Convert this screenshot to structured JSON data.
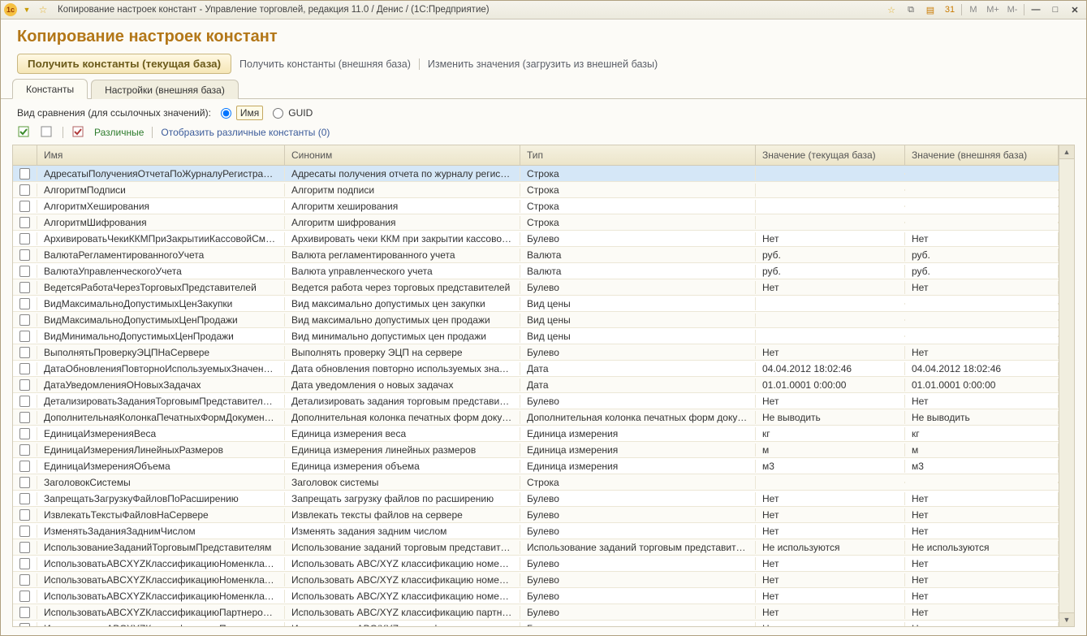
{
  "titlebar": {
    "title": "Копирование настроек констант - Управление торговлей, редакция 11.0 / Денис /  (1С:Предприятие)"
  },
  "page_title": "Копирование настроек констант",
  "actions": {
    "get_current": "Получить константы (текущая база)",
    "get_external": "Получить константы (внешняя база)",
    "change_values": "Изменить значения (загрузить из внешней базы)"
  },
  "tabs": {
    "constants": "Константы",
    "settings_ext": "Настройки (внешняя база)"
  },
  "compare_mode": {
    "label": "Вид сравнения (для ссылочных значений):",
    "name": "Имя",
    "guid": "GUID"
  },
  "subtools": {
    "diff": "Различные",
    "show_diff": "Отобразить различные константы (0)"
  },
  "columns": {
    "name": "Имя",
    "syn": "Синоним",
    "type": "Тип",
    "v1": "Значение (текущая база)",
    "v2": "Значение (внешняя база)"
  },
  "rows": [
    {
      "name": "АдресатыПолученияОтчетаПоЖурналуРегистрации",
      "syn": "Адресаты получения отчета по журналу регистрации",
      "type": "Строка",
      "v1": "",
      "v2": "",
      "selected": true
    },
    {
      "name": "АлгоритмПодписи",
      "syn": "Алгоритм подписи",
      "type": "Строка",
      "v1": "",
      "v2": ""
    },
    {
      "name": "АлгоритмХеширования",
      "syn": "Алгоритм хеширования",
      "type": "Строка",
      "v1": "",
      "v2": ""
    },
    {
      "name": "АлгоритмШифрования",
      "syn": "Алгоритм шифрования",
      "type": "Строка",
      "v1": "",
      "v2": ""
    },
    {
      "name": "АрхивироватьЧекиККМПриЗакрытииКассовойСмены",
      "syn": "Архивировать чеки ККМ при закрытии кассовой сме...",
      "type": "Булево",
      "v1": "Нет",
      "v2": "Нет"
    },
    {
      "name": "ВалютаРегламентированногоУчета",
      "syn": "Валюта регламентированного учета",
      "type": "Валюта",
      "v1": "руб.",
      "v2": "руб."
    },
    {
      "name": "ВалютаУправленческогоУчета",
      "syn": "Валюта управленческого учета",
      "type": "Валюта",
      "v1": "руб.",
      "v2": "руб."
    },
    {
      "name": "ВедетсяРаботаЧерезТорговыхПредставителей",
      "syn": "Ведется работа через торговых представителей",
      "type": "Булево",
      "v1": "Нет",
      "v2": "Нет"
    },
    {
      "name": "ВидМаксимальноДопустимыхЦенЗакупки",
      "syn": "Вид максимально допустимых цен закупки",
      "type": "Вид цены",
      "v1": "",
      "v2": ""
    },
    {
      "name": "ВидМаксимальноДопустимыхЦенПродажи",
      "syn": "Вид максимально допустимых цен продажи",
      "type": "Вид цены",
      "v1": "",
      "v2": ""
    },
    {
      "name": "ВидМинимальноДопустимыхЦенПродажи",
      "syn": "Вид минимально допустимых цен продажи",
      "type": "Вид цены",
      "v1": "",
      "v2": ""
    },
    {
      "name": "ВыполнятьПроверкуЭЦПНаСервере",
      "syn": "Выполнять проверку ЭЦП на сервере",
      "type": "Булево",
      "v1": "Нет",
      "v2": "Нет"
    },
    {
      "name": "ДатаОбновленияПовторноИспользуемыхЗначенийМРО",
      "syn": "Дата обновления повторно используемых значений ...",
      "type": "Дата",
      "v1": "04.04.2012 18:02:46",
      "v2": "04.04.2012 18:02:46"
    },
    {
      "name": "ДатаУведомленияОНовыхЗадачах",
      "syn": "Дата уведомления о новых задачах",
      "type": "Дата",
      "v1": "01.01.0001 0:00:00",
      "v2": "01.01.0001 0:00:00"
    },
    {
      "name": "ДетализироватьЗаданияТорговымПредставителямПоН...",
      "syn": "Детализировать задания торговым представителям ...",
      "type": "Булево",
      "v1": "Нет",
      "v2": "Нет"
    },
    {
      "name": "ДополнительнаяКолонкаПечатныхФормДокументов",
      "syn": "Дополнительная колонка печатных форм документов",
      "type": "Дополнительная колонка печатных форм документов",
      "v1": "Не выводить",
      "v2": "Не выводить"
    },
    {
      "name": "ЕдиницаИзмеренияВеса",
      "syn": "Единица измерения веса",
      "type": "Единица измерения",
      "v1": "кг",
      "v2": "кг"
    },
    {
      "name": "ЕдиницаИзмеренияЛинейныхРазмеров",
      "syn": "Единица измерения линейных размеров",
      "type": "Единица измерения",
      "v1": "м",
      "v2": "м"
    },
    {
      "name": "ЕдиницаИзмеренияОбъема",
      "syn": "Единица измерения объема",
      "type": "Единица измерения",
      "v1": "м3",
      "v2": "м3"
    },
    {
      "name": "ЗаголовокСистемы",
      "syn": "Заголовок системы",
      "type": "Строка",
      "v1": "",
      "v2": ""
    },
    {
      "name": "ЗапрещатьЗагрузкуФайловПоРасширению",
      "syn": "Запрещать загрузку файлов по расширению",
      "type": "Булево",
      "v1": "Нет",
      "v2": "Нет"
    },
    {
      "name": "ИзвлекатьТекстыФайловНаСервере",
      "syn": "Извлекать тексты файлов на сервере",
      "type": "Булево",
      "v1": "Нет",
      "v2": "Нет"
    },
    {
      "name": "ИзменятьЗаданияЗаднимЧислом",
      "syn": "Изменять задания задним числом",
      "type": "Булево",
      "v1": "Нет",
      "v2": "Нет"
    },
    {
      "name": "ИспользованиеЗаданийТорговымПредставителям",
      "syn": "Использование заданий торговым представителям",
      "type": "Использование заданий торговым представителям",
      "v1": "Не используются",
      "v2": "Не используются"
    },
    {
      "name": "ИспользоватьABCXYZКлассификациюНоменклатурыПо...",
      "syn": "Использовать ABC/XYZ классификацию номенклату...",
      "type": "Булево",
      "v1": "Нет",
      "v2": "Нет"
    },
    {
      "name": "ИспользоватьABCXYZКлассификациюНоменклатурыПо...",
      "syn": "Использовать ABC/XYZ классификацию номенклат...",
      "type": "Булево",
      "v1": "Нет",
      "v2": "Нет"
    },
    {
      "name": "ИспользоватьABCXYZКлассификациюНоменклатурыПо...",
      "syn": "Использовать ABC/XYZ классификацию номенклат...",
      "type": "Булево",
      "v1": "Нет",
      "v2": "Нет"
    },
    {
      "name": "ИспользоватьABCXYZКлассификациюПартнеровПоВал...",
      "syn": "Использовать ABC/XYZ классификацию партнеров п...",
      "type": "Булево",
      "v1": "Нет",
      "v2": "Нет"
    },
    {
      "name": "ИспользоватьABCXYZКлассификациюПартнеровПоВыр...",
      "syn": "Использовать ABC/XYZ классификацию партнеров п...",
      "type": "Булево",
      "v1": "Нет",
      "v2": "Нет"
    }
  ]
}
